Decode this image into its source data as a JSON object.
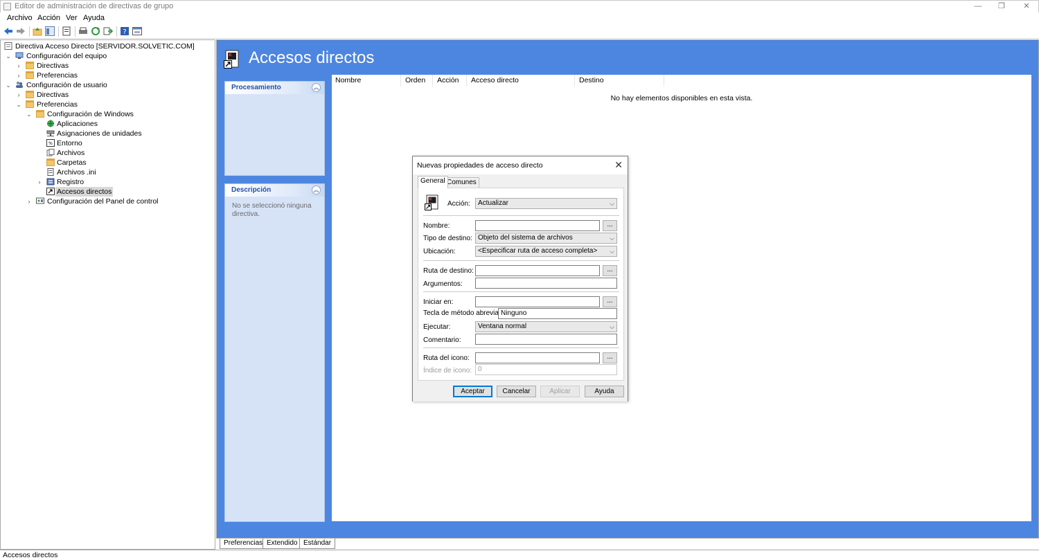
{
  "window": {
    "title": "Editor de administración de directivas de grupo",
    "minimize": "—",
    "restore": "❐",
    "close": "✕"
  },
  "menu": [
    "Archivo",
    "Acción",
    "Ver",
    "Ayuda"
  ],
  "tree": {
    "root": "Directiva Acceso Directo [SERVIDOR.SOLVETIC.COM]",
    "computer_config": "Configuración del equipo",
    "computer_policies": "Directivas",
    "computer_prefs": "Preferencias",
    "user_config": "Configuración de usuario",
    "user_policies": "Directivas",
    "user_prefs": "Preferencias",
    "windows_config": "Configuración de Windows",
    "items": [
      "Aplicaciones",
      "Asignaciones de unidades",
      "Entorno",
      "Archivos",
      "Carpetas",
      "Archivos .ini",
      "Registro",
      "Accesos directos"
    ],
    "control_panel": "Configuración del Panel de control"
  },
  "main": {
    "title": "Accesos directos",
    "processing_title": "Procesamiento",
    "description_title": "Descripción",
    "description_text": "No se seleccionó ninguna directiva.",
    "columns": [
      "Nombre",
      "Orden",
      "Acción",
      "Acceso directo",
      "Destino"
    ],
    "empty_message": "No hay elementos disponibles en esta vista."
  },
  "bottom_tabs": [
    "Preferencias",
    "Extendido",
    "Estándar"
  ],
  "status": "Accesos directos",
  "dialog": {
    "title": "Nuevas propiedades de acceso directo",
    "tabs": [
      "General",
      "Comunes"
    ],
    "accion_label": "Acción:",
    "accion_value": "Actualizar",
    "nombre_label": "Nombre:",
    "nombre_value": "",
    "tipo_label": "Tipo de destino:",
    "tipo_value": "Objeto del sistema de archivos",
    "ubicacion_label": "Ubicación:",
    "ubicacion_value": "<Especificar ruta de acceso completa>",
    "ruta_destino_label": "Ruta de destino:",
    "ruta_destino_value": "",
    "argumentos_label": "Argumentos:",
    "argumentos_value": "",
    "iniciar_label": "Iniciar en:",
    "iniciar_value": "",
    "tecla_label": "Tecla de método abreviado:",
    "tecla_value": "Ninguno",
    "ejecutar_label": "Ejecutar:",
    "ejecutar_value": "Ventana normal",
    "comentario_label": "Comentario:",
    "comentario_value": "",
    "ruta_icono_label": "Ruta del icono:",
    "ruta_icono_value": "",
    "indice_label": "Índice de icono:",
    "indice_value": "0",
    "browse": "...",
    "buttons": {
      "ok": "Aceptar",
      "cancel": "Cancelar",
      "apply": "Aplicar",
      "help": "Ayuda"
    }
  },
  "colors": {
    "accent": "#4d86e0",
    "panel": "#d6e3f7",
    "panel_title": "#1f4fa8"
  }
}
